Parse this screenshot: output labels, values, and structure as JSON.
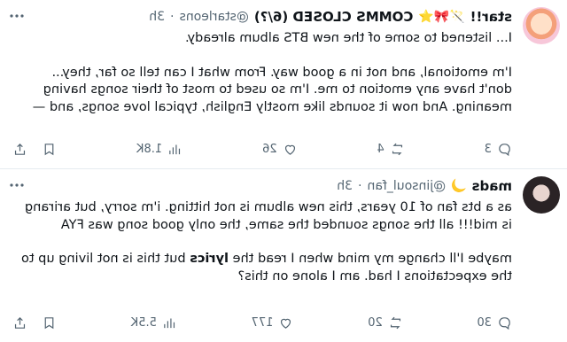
{
  "tweets": [
    {
      "name": "star!!",
      "emojis": "🪄🎀⭐",
      "display_suffix": "COMMS CLOSED (6/?)",
      "handle": "@starleons",
      "dot": "·",
      "time": "3h",
      "paragraphs": [
        "I... listened to some of the new BTS album already.",
        "I'm emotional, and not in a good way. From what I can tell so far, they... don't have any emotion to me. I'm so used to most of their songs having meaning. And now it sounds like mostly English, typical love songs, and —"
      ],
      "replies": "3",
      "reposts": "4",
      "likes": "26",
      "views": "1.8K"
    },
    {
      "name": "mads",
      "emojis": "🌙",
      "display_suffix": "",
      "handle": "@jinsoul_fan",
      "dot": "·",
      "time": "3h",
      "paragraphs": [
        "as a bts fan of 10 years, this new album is not hitting. i'm sorry, but arirang is mid!!! all the songs sounded the same, the only good song was FYA",
        "maybe I'll change my mind when I read the lyrics but this is not living up to the expectations I had. am I alone on this?"
      ],
      "replies": "30",
      "reposts": "20",
      "likes": "177",
      "views": "5.5K"
    }
  ],
  "icons": [
    "more-icon",
    "reply-icon",
    "repost-icon",
    "like-icon",
    "views-icon",
    "bookmark-icon",
    "share-icon"
  ]
}
